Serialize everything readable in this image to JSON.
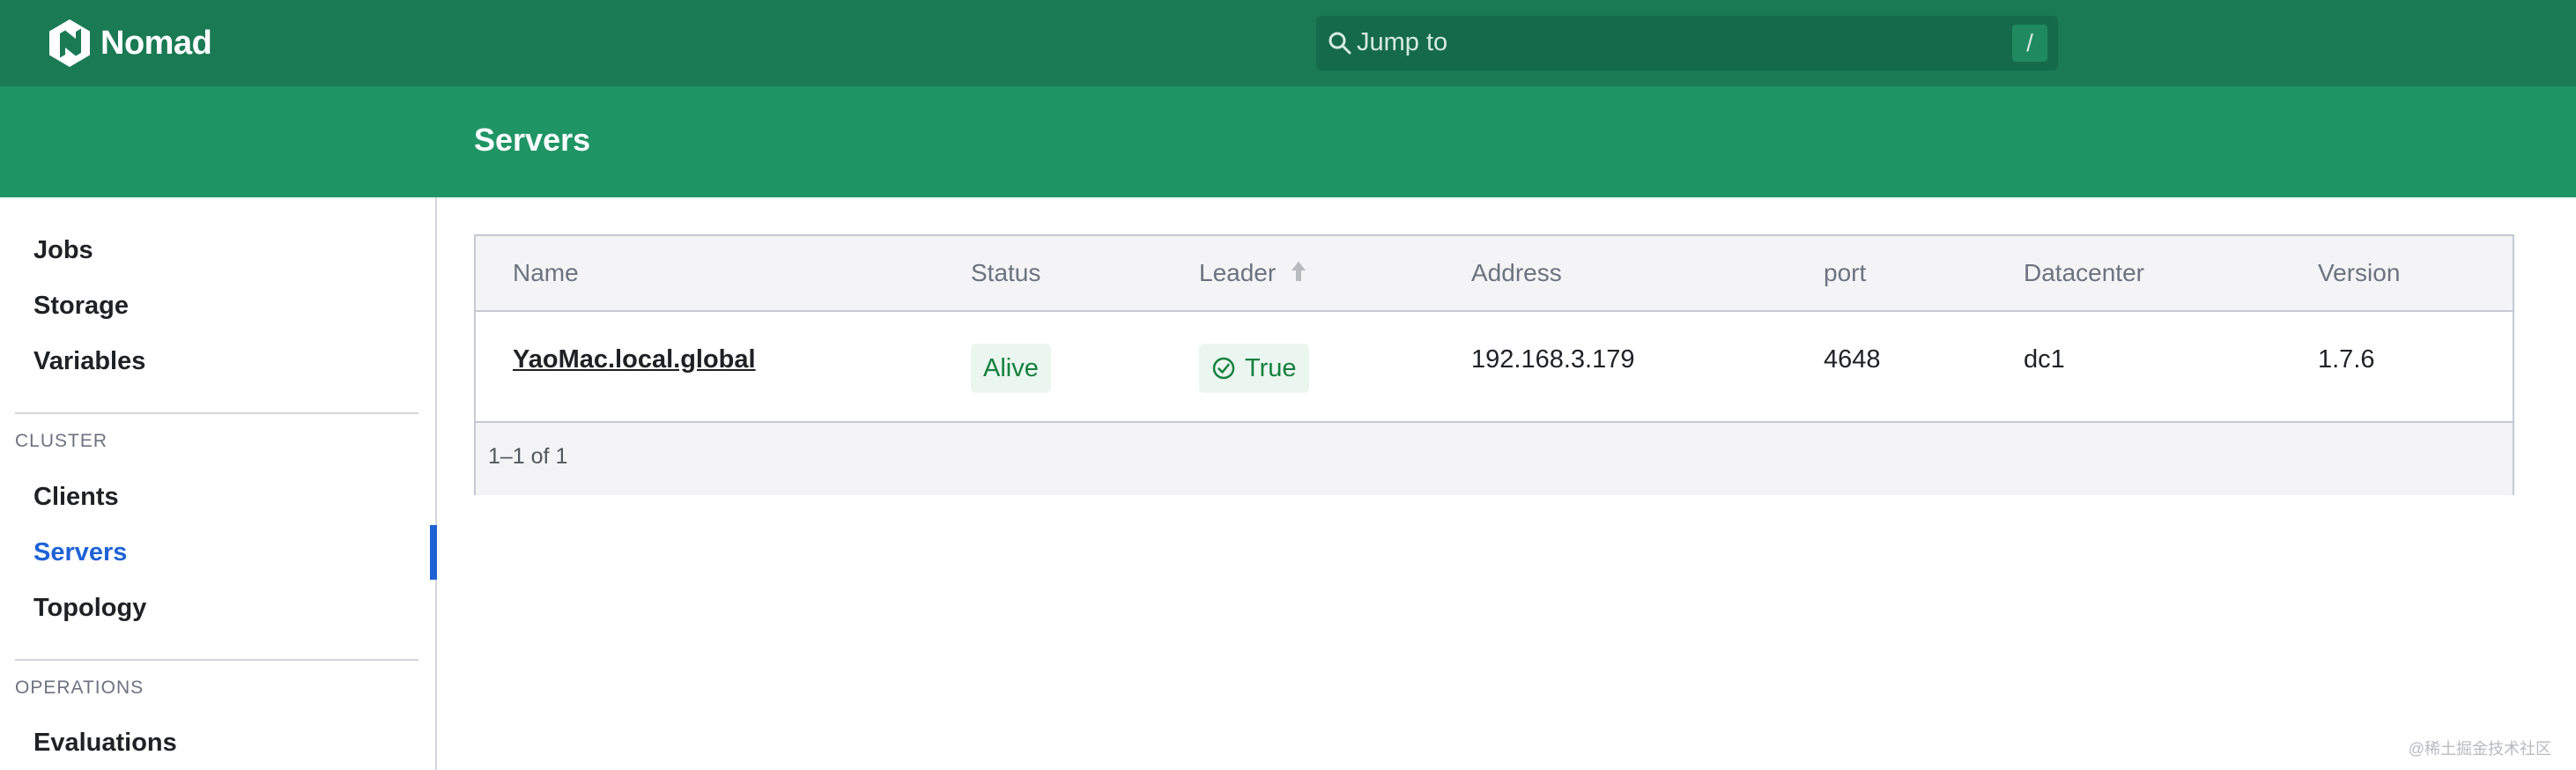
{
  "brand": {
    "name": "Nomad"
  },
  "search": {
    "placeholder": "Jump to",
    "shortcut": "/"
  },
  "page": {
    "title": "Servers"
  },
  "sidebar": {
    "top_items": [
      {
        "label": "Jobs"
      },
      {
        "label": "Storage"
      },
      {
        "label": "Variables"
      }
    ],
    "cluster_label": "CLUSTER",
    "cluster_items": [
      {
        "label": "Clients"
      },
      {
        "label": "Servers",
        "active": true
      },
      {
        "label": "Topology"
      }
    ],
    "operations_label": "OPERATIONS",
    "operations_items": [
      {
        "label": "Evaluations"
      }
    ]
  },
  "table": {
    "columns": [
      "Name",
      "Status",
      "Leader",
      "Address",
      "port",
      "Datacenter",
      "Version"
    ],
    "sorted_column": "Leader",
    "sort_direction": "asc",
    "rows": [
      {
        "name": "YaoMac.local.global",
        "status": "Alive",
        "leader": "True",
        "address": "192.168.3.179",
        "port": "4648",
        "datacenter": "dc1",
        "version": "1.7.6"
      }
    ],
    "pagination": "1–1 of 1"
  },
  "watermark": "@稀土掘金技术社区",
  "colors": {
    "topbar": "#1a7a54",
    "header_band": "#1f9565",
    "active_nav": "#1e62d6",
    "badge_text": "#15803d"
  }
}
